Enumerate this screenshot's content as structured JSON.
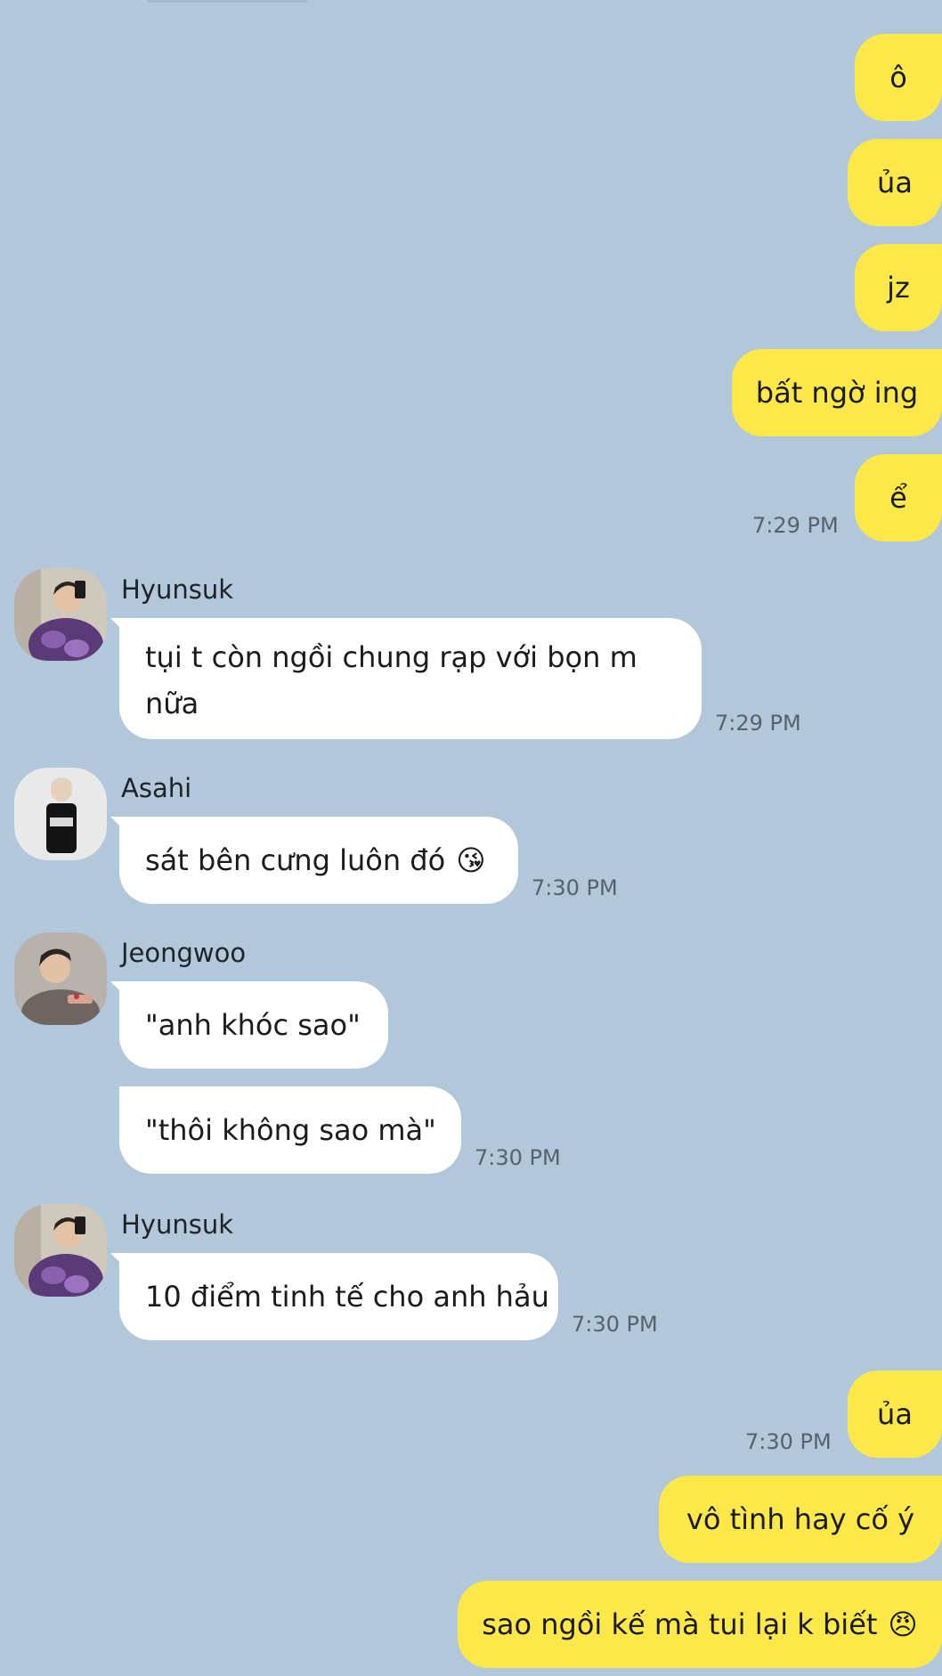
{
  "colors": {
    "background": "#b2c7da",
    "my_bubble": "#fde84a",
    "their_bubble": "#ffffff",
    "timestamp": "#55626e"
  },
  "messages": {
    "m1": "ô",
    "m2": "ủa",
    "m3": "jz",
    "m4": "bất ngờ ing",
    "m5": "ể",
    "t1": "7:29 PM",
    "hyunsuk1_name": "Hyunsuk",
    "hyunsuk1_text": "tụi t còn ngồi chung rạp với bọn m nữa",
    "t2": "7:29 PM",
    "asahi_name": "Asahi",
    "asahi_text": "sát bên cưng luôn đó",
    "asahi_emoji": "😘",
    "t3": "7:30 PM",
    "jeongwoo_name": "Jeongwoo",
    "jeongwoo_text1": "\"anh khóc sao\"",
    "jeongwoo_text2": "\"thôi không sao mà\"",
    "t4": "7:30 PM",
    "hyunsuk2_name": "Hyunsuk",
    "hyunsuk2_text": "10 điểm tinh tế cho anh hảu",
    "t5": "7:30 PM",
    "m6": "ủa",
    "t6": "7:30 PM",
    "m7": "vô tình hay cố ý",
    "m8": "sao ngồi kế mà tui lại k biết",
    "m8_emoji": "😠"
  },
  "icons": {
    "avatar_hyunsuk": "avatar-photo",
    "avatar_asahi": "avatar-photo",
    "avatar_jeongwoo": "avatar-photo"
  }
}
